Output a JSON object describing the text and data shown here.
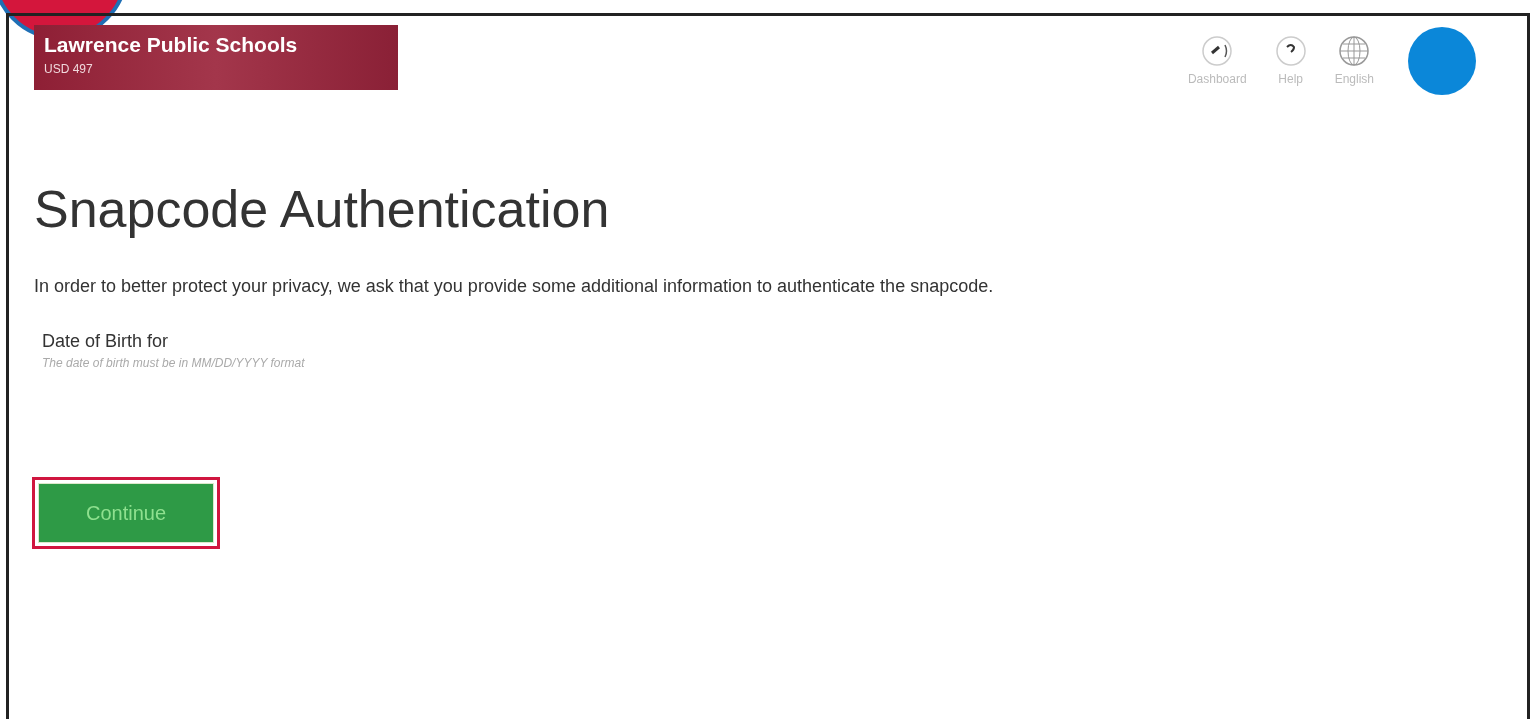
{
  "header": {
    "district_name": "Lawrence Public Schools",
    "district_code": "USD 497",
    "nav": [
      {
        "kind": "dashboard",
        "label": "Dashboard"
      },
      {
        "kind": "help",
        "label": "Help"
      },
      {
        "kind": "language",
        "label": "English"
      }
    ]
  },
  "page": {
    "title": "Snapcode Authentication",
    "intro": "In order to better protect your privacy, we ask that you provide some additional information to authenticate the snapcode.",
    "field_label": "Date of Birth for",
    "field_hint": "The date of birth must be in MM/DD/YYYY format",
    "button": "Continue"
  }
}
